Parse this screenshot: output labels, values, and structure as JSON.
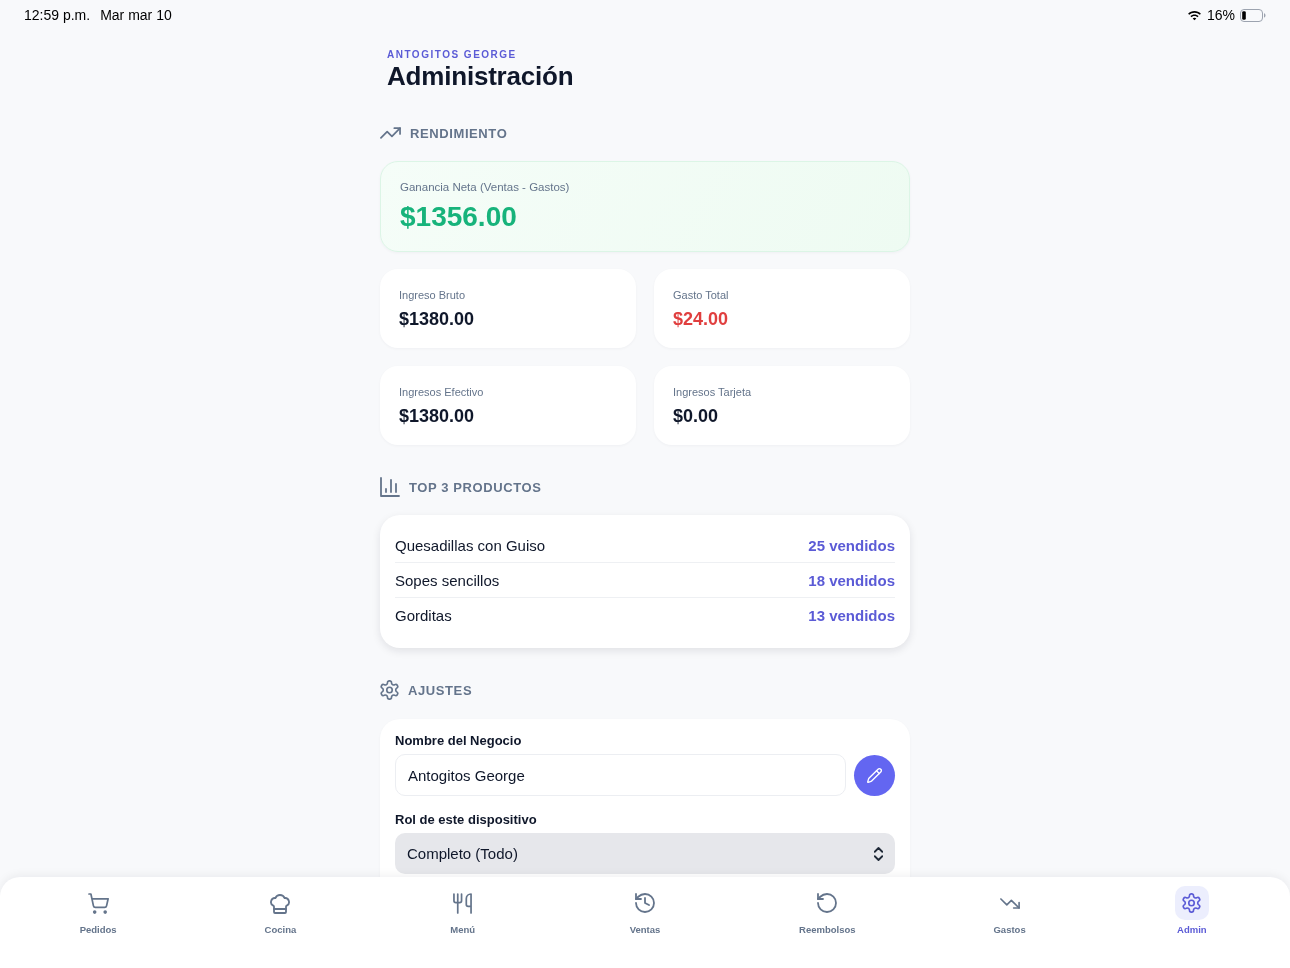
{
  "status_bar": {
    "time": "12:59 p.m.",
    "date": "Mar mar 10",
    "battery": "16%"
  },
  "header": {
    "eyebrow": "ANTOGITOS GEORGE",
    "title": "Administración"
  },
  "performance": {
    "heading": "RENDIMIENTO",
    "net_profit": {
      "label": "Ganancia Neta (Ventas - Gastos)",
      "value": "$1356.00"
    },
    "stats": [
      {
        "label": "Ingreso Bruto",
        "value": "$1380.00",
        "color": "#0f172a"
      },
      {
        "label": "Gasto Total",
        "value": "$24.00",
        "color": "#e03e3e"
      },
      {
        "label": "Ingresos Efectivo",
        "value": "$1380.00",
        "color": "#0f172a"
      },
      {
        "label": "Ingresos Tarjeta",
        "value": "$0.00",
        "color": "#0f172a"
      }
    ]
  },
  "top_products": {
    "heading": "TOP 3 PRODUCTOS",
    "rows": [
      {
        "name": "Quesadillas con Guiso",
        "sold": "25 vendidos"
      },
      {
        "name": "Sopes sencillos",
        "sold": "18 vendidos"
      },
      {
        "name": "Gorditas",
        "sold": "13 vendidos"
      }
    ]
  },
  "settings": {
    "heading": "AJUSTES",
    "business_name": {
      "label": "Nombre del Negocio",
      "value": "Antogitos George"
    },
    "device_role": {
      "label": "Rol de este dispositivo",
      "value": "Completo (Todo)"
    }
  },
  "nav": {
    "items": [
      {
        "label": "Pedidos",
        "selected": false
      },
      {
        "label": "Cocina",
        "selected": false
      },
      {
        "label": "Menú",
        "selected": false
      },
      {
        "label": "Ventas",
        "selected": false
      },
      {
        "label": "Reembolsos",
        "selected": false
      },
      {
        "label": "Gastos",
        "selected": false
      },
      {
        "label": "Admin",
        "selected": true
      }
    ]
  }
}
